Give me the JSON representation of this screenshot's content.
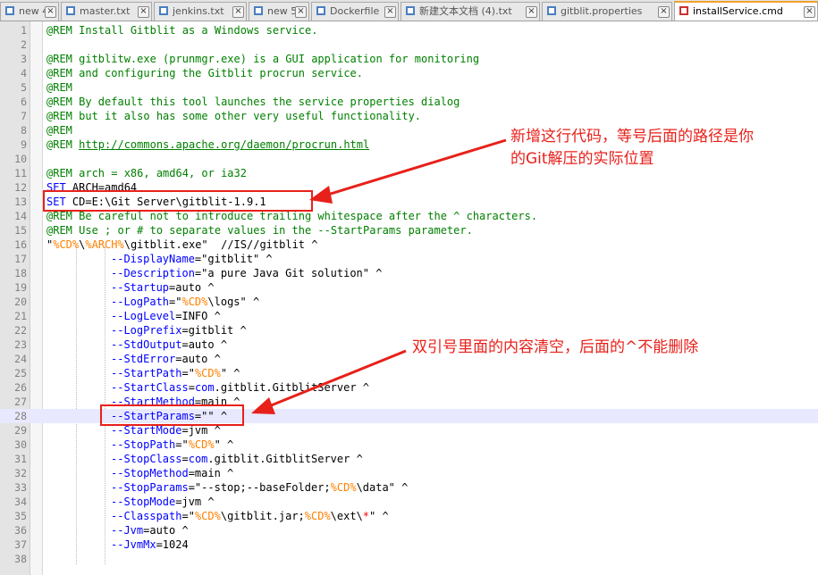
{
  "tabs": [
    {
      "label": "new 4",
      "icon": "document-icon"
    },
    {
      "label": "master.txt",
      "icon": "document-icon"
    },
    {
      "label": "jenkins.txt",
      "icon": "document-icon"
    },
    {
      "label": "new 5",
      "icon": "document-icon"
    },
    {
      "label": "Dockerfile",
      "icon": "document-icon"
    },
    {
      "label": "新建文本文档 (4).txt",
      "icon": "document-icon"
    },
    {
      "label": "gitblit.properties",
      "icon": "document-icon"
    },
    {
      "label": "installService.cmd",
      "icon": "document-icon",
      "active": true
    }
  ],
  "lines": {
    "n1": "1",
    "n2": "2",
    "n3": "3",
    "n4": "4",
    "n5": "5",
    "n6": "6",
    "n7": "7",
    "n8": "8",
    "n9": "9",
    "n10": "10",
    "n11": "11",
    "n12": "12",
    "n13": "13",
    "n14": "14",
    "n15": "15",
    "n16": "16",
    "n17": "17",
    "n18": "18",
    "n19": "19",
    "n20": "20",
    "n21": "21",
    "n22": "22",
    "n23": "23",
    "n24": "24",
    "n25": "25",
    "n26": "26",
    "n27": "27",
    "n28": "28",
    "n29": "29",
    "n30": "30",
    "n31": "31",
    "n32": "32",
    "n33": "33",
    "n34": "34",
    "n35": "35",
    "n36": "36",
    "n37": "37",
    "n38": "38"
  },
  "code": {
    "l1": "@REM Install Gitblit as a Windows service.",
    "l3": "@REM gitblitw.exe (prunmgr.exe) is a GUI application for monitoring",
    "l4": "@REM and configuring the Gitblit procrun service.",
    "l5": "@REM",
    "l6": "@REM By default this tool launches the service properties dialog",
    "l7": "@REM but it also has some other very useful functionality.",
    "l8": "@REM",
    "l9a": "@REM ",
    "l9b": "http://commons.apache.org/daemon/procrun.html",
    "l11": "@REM arch = x86, amd64, or ia32",
    "l12a": "SET",
    "l12b": " ARCH=amd64",
    "l13a": "SET",
    "l13b": " CD=E:\\Git Server\\gitblit-1.9.1",
    "l14": "@REM Be careful not to introduce trailing whitespace after the ^ characters.",
    "l15": "@REM Use ; or # to separate values in the --StartParams parameter.",
    "l16a": "\"",
    "l16b": "%CD%",
    "l16c": "\\",
    "l16d": "%ARCH%",
    "l16e": "\\gitblit.exe\"  //IS//gitblit ^",
    "l17a": "--DisplayName",
    "l17b": "=\"gitblit\" ^",
    "l18a": "--Description",
    "l18b": "=\"a pure Java Git solution\" ^",
    "l19a": "--Startup",
    "l19b": "=auto ^",
    "l20a": "--LogPath",
    "l20b": "=\"",
    "l20c": "%CD%",
    "l20d": "\\logs\" ^",
    "l21a": "--LogLevel",
    "l21b": "=INFO ^",
    "l22a": "--LogPrefix",
    "l22b": "=gitblit ^",
    "l23a": "--StdOutput",
    "l23b": "=auto ^",
    "l24a": "--StdError",
    "l24b": "=auto ^",
    "l25a": "--StartPath",
    "l25b": "=\"",
    "l25c": "%CD%",
    "l25d": "\" ^",
    "l26a": "--StartClass",
    "l26b": "=",
    "l26c": "com",
    "l26d": ".gitblit.GitblitServer ^",
    "l27a": "--StartMethod",
    "l27b": "=main ^",
    "l28a": "--StartParams",
    "l28b": "=\"\" ^",
    "l29a": "--StartMode",
    "l29b": "=jvm ^",
    "l30a": "--StopPath",
    "l30b": "=\"",
    "l30c": "%CD%",
    "l30d": "\" ^",
    "l31a": "--StopClass",
    "l31b": "=",
    "l31c": "com",
    "l31d": ".gitblit.GitblitServer ^",
    "l32a": "--StopMethod",
    "l32b": "=main ^",
    "l33a": "--StopParams",
    "l33b": "=\"--stop;--baseFolder;",
    "l33c": "%CD%",
    "l33d": "\\data\" ^",
    "l34a": "--StopMode",
    "l34b": "=jvm ^",
    "l35a": "--Classpath",
    "l35b": "=\"",
    "l35c": "%CD%",
    "l35d": "\\gitblit.jar;",
    "l35e": "%CD%",
    "l35f": "\\ext\\",
    "l35g": "*",
    "l35h": "\" ^",
    "l36a": "--Jvm",
    "l36b": "=auto ^",
    "l37a": "--JvmMx",
    "l37b": "=1024"
  },
  "annotations": {
    "note1_line1": "新增这行代码，等号后面的路径是你",
    "note1_line2": "的Git解压的实际位置",
    "note2": "双引号里面的内容清空，后面的^不能删除"
  },
  "colors": {
    "comment": "#008000",
    "keyword": "#0000ff",
    "variable": "#ff8000",
    "annotation": "#e8201a",
    "current_line": "#e8e8ff"
  }
}
